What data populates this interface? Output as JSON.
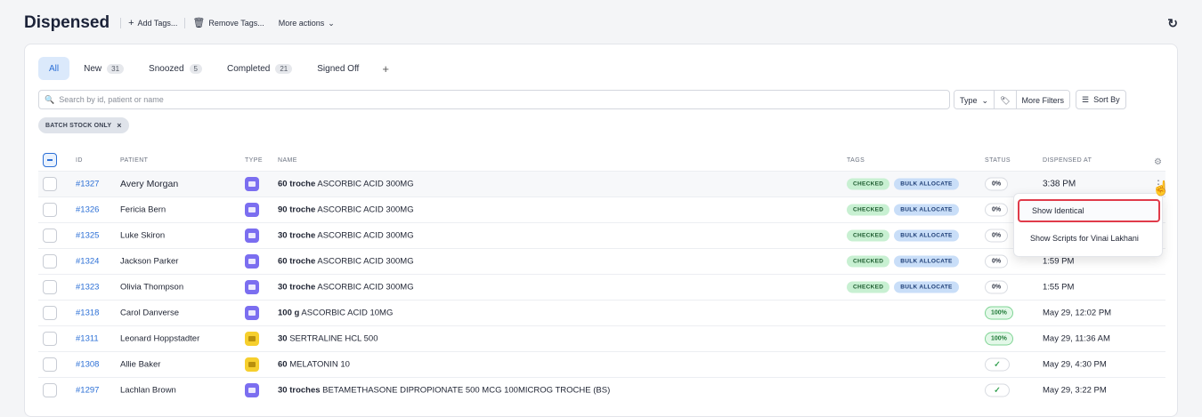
{
  "header": {
    "title": "Dispensed",
    "add_tags": "Add Tags...",
    "remove_tags": "Remove Tags...",
    "more_actions": "More actions"
  },
  "tabs": [
    {
      "label": "All",
      "count": null
    },
    {
      "label": "New",
      "count": "31"
    },
    {
      "label": "Snoozed",
      "count": "5"
    },
    {
      "label": "Completed",
      "count": "21"
    },
    {
      "label": "Signed Off",
      "count": null
    }
  ],
  "tab_add": "+",
  "search": {
    "placeholder": "Search by id, patient or name"
  },
  "filters": {
    "type": "Type",
    "more_filters": "More Filters",
    "sort_by": "Sort By"
  },
  "active_chip": {
    "label": "BATCH STOCK ONLY",
    "remove": "×"
  },
  "columns": {
    "id": "ID",
    "patient": "PATIENT",
    "type": "TYPE",
    "name": "NAME",
    "tags": "TAGS",
    "status": "STATUS",
    "dispensed_at": "DISPENSED AT"
  },
  "rows": [
    {
      "id": "#1327",
      "patient": "Avery Morgan",
      "type": "purple",
      "qty": "60 troche",
      "drug": " ASCORBIC ACID 300MG",
      "tags": [
        "CHECKED",
        "BULK ALLOCATE"
      ],
      "status": "0%",
      "dispensed_at": "3:38 PM"
    },
    {
      "id": "#1326",
      "patient": "Fericia Bern",
      "type": "purple",
      "qty": "90 troche",
      "drug": " ASCORBIC ACID 300MG",
      "tags": [
        "CHECKED",
        "BULK ALLOCATE"
      ],
      "status": "0%",
      "dispensed_at": ""
    },
    {
      "id": "#1325",
      "patient": "Luke Skiron",
      "type": "purple",
      "qty": "30 troche",
      "drug": " ASCORBIC ACID 300MG",
      "tags": [
        "CHECKED",
        "BULK ALLOCATE"
      ],
      "status": "0%",
      "dispensed_at": ""
    },
    {
      "id": "#1324",
      "patient": "Jackson Parker",
      "type": "purple",
      "qty": "60 troche",
      "drug": " ASCORBIC ACID 300MG",
      "tags": [
        "CHECKED",
        "BULK ALLOCATE"
      ],
      "status": "0%",
      "dispensed_at": "1:59 PM"
    },
    {
      "id": "#1323",
      "patient": "Olivia Thompson",
      "type": "purple",
      "qty": "30 troche",
      "drug": " ASCORBIC ACID 300MG",
      "tags": [
        "CHECKED",
        "BULK ALLOCATE"
      ],
      "status": "0%",
      "dispensed_at": "1:55 PM"
    },
    {
      "id": "#1318",
      "patient": "Carol Danverse",
      "type": "purple",
      "qty": "100 g",
      "drug": " ASCORBIC ACID 10MG",
      "tags": [],
      "status": "100%",
      "dispensed_at": "May 29, 12:02 PM"
    },
    {
      "id": "#1311",
      "patient": "Leonard Hoppstadter",
      "type": "yellow",
      "qty": "30",
      "drug": " SERTRALINE HCL 500",
      "tags": [],
      "status": "100%",
      "dispensed_at": "May 29, 11:36 AM"
    },
    {
      "id": "#1308",
      "patient": "Allie Baker",
      "type": "yellow",
      "qty": "60",
      "drug": " MELATONIN 10",
      "tags": [],
      "status": "✓",
      "dispensed_at": "May 29, 4:30 PM"
    },
    {
      "id": "#1297",
      "patient": "Lachlan Brown",
      "type": "purple",
      "qty": "30 troches",
      "drug": " BETAMETHASONE DIPROPIONATE 500 MCG 100MICROG TROCHE (BS)",
      "tags": [],
      "status": "✓",
      "dispensed_at": "May 29, 3:22 PM"
    }
  ],
  "context_menu": {
    "show_identical": "Show Identical",
    "show_scripts": "Show Scripts for Vinai Lakhani"
  },
  "colors": {
    "accent": "#2b6fd6",
    "type_purple": "#7b6ef0",
    "type_yellow": "#f6cf2d",
    "tag_green": "#c8f0d2",
    "tag_blue": "#c9def8",
    "menu_highlight": "#e03b4a"
  }
}
